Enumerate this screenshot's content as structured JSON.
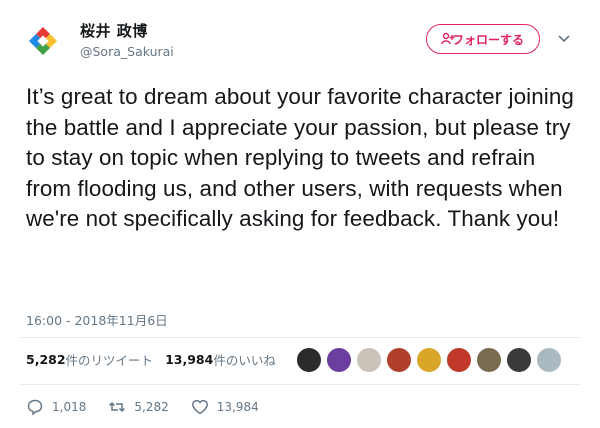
{
  "header": {
    "display_name": "桜井 政博",
    "handle": "@Sora_Sakurai",
    "follow_label": "フォローする"
  },
  "tweet": {
    "text": "It’s great to dream about your favorite character joining the battle and I appreciate your passion, but please try to stay on topic when replying to tweets and refrain from flooding us, and other users, with requests when we're not specifically asking for feedback. Thank you!",
    "timestamp": "16:00 - 2018年11月6日"
  },
  "stats": {
    "retweets_count": "5,282",
    "retweets_label": "件のリツイート",
    "likes_count": "13,984",
    "likes_label": "件のいいね"
  },
  "likers": [
    {
      "icon": "liker-avatar-1",
      "color": "#2b2b2b"
    },
    {
      "icon": "liker-avatar-2",
      "color": "#6a3fa0"
    },
    {
      "icon": "liker-avatar-3",
      "color": "#c8c2b8"
    },
    {
      "icon": "liker-avatar-4",
      "color": "#b0402a"
    },
    {
      "icon": "liker-avatar-5",
      "color": "#d9a62a"
    },
    {
      "icon": "liker-avatar-6",
      "color": "#c0392b"
    },
    {
      "icon": "liker-avatar-7",
      "color": "#7a6a50"
    },
    {
      "icon": "liker-avatar-8",
      "color": "#3a3a3a"
    },
    {
      "icon": "liker-avatar-9",
      "color": "#aab8c2"
    }
  ],
  "actions": {
    "replies": "1,018",
    "retweets": "5,282",
    "likes": "13,984"
  },
  "colors": {
    "accent": "#e0245e",
    "muted": "#657786",
    "divider": "#e6ecf0"
  }
}
